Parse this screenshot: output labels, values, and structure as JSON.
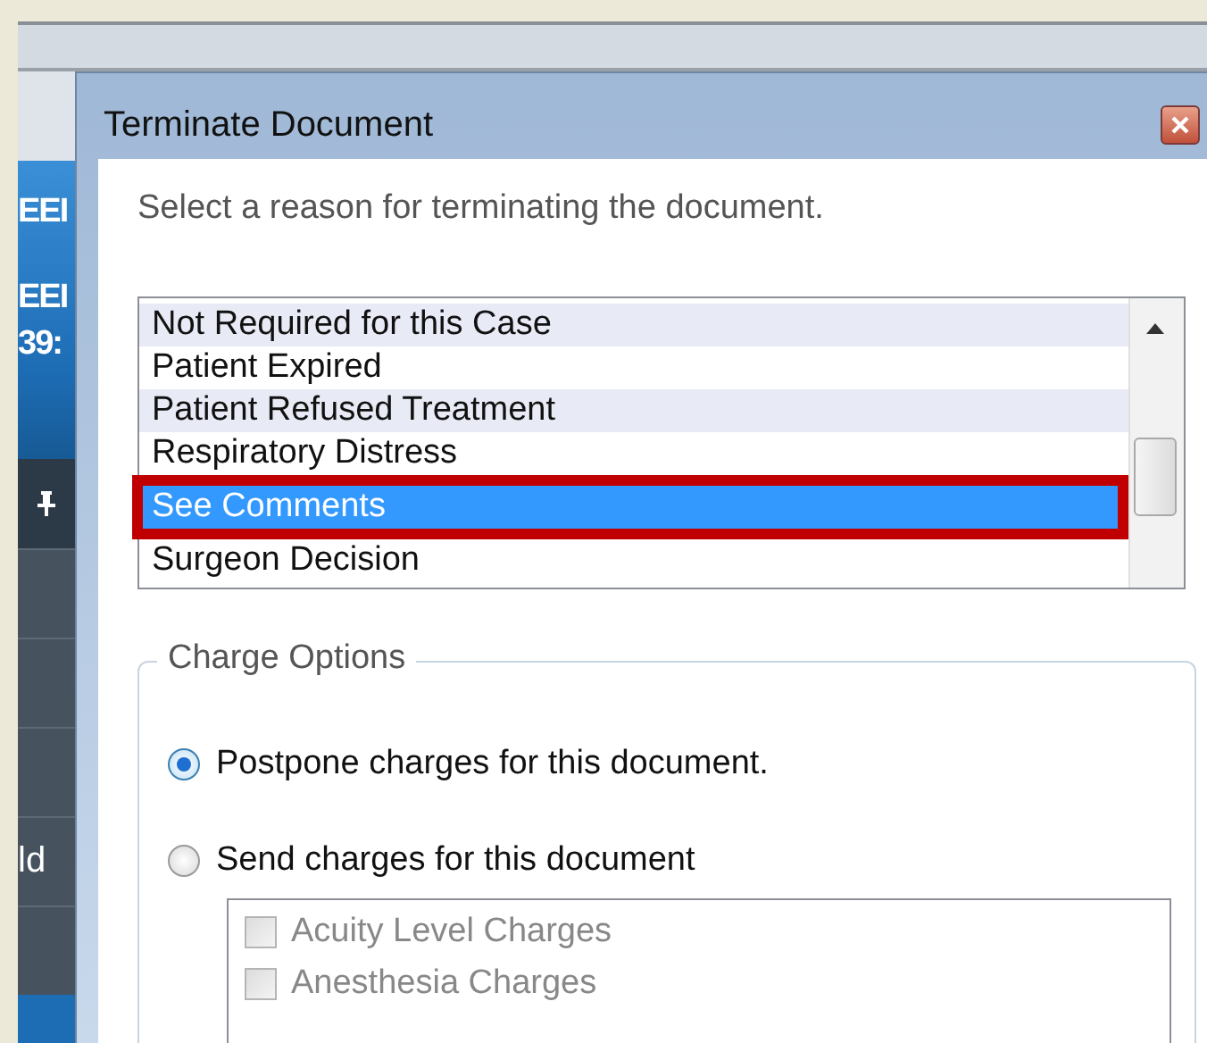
{
  "background_app": {
    "header_texts": [
      "EEI",
      "EEI",
      "39:"
    ],
    "row_texts": [
      "ld"
    ]
  },
  "dialog": {
    "title": "Terminate Document",
    "prompt": "Select a reason for terminating the document.",
    "reasons": [
      {
        "label": "Not Required for this Case",
        "selected": false,
        "highlighted": false
      },
      {
        "label": "Patient Expired",
        "selected": false,
        "highlighted": false
      },
      {
        "label": "Patient Refused Treatment",
        "selected": false,
        "highlighted": false
      },
      {
        "label": "Respiratory Distress",
        "selected": false,
        "highlighted": false
      },
      {
        "label": "See Comments",
        "selected": true,
        "highlighted": true
      },
      {
        "label": "Surgeon Decision",
        "selected": false,
        "highlighted": false
      }
    ],
    "charge_options": {
      "title": "Charge Options",
      "options": [
        {
          "label": "Postpone charges for this document.",
          "selected": true
        },
        {
          "label": "Send charges for this document",
          "selected": false
        }
      ],
      "charges": [
        {
          "label": "Acuity Level Charges",
          "checked": false,
          "disabled": true
        },
        {
          "label": "Anesthesia Charges",
          "checked": false,
          "disabled": true
        }
      ]
    }
  }
}
